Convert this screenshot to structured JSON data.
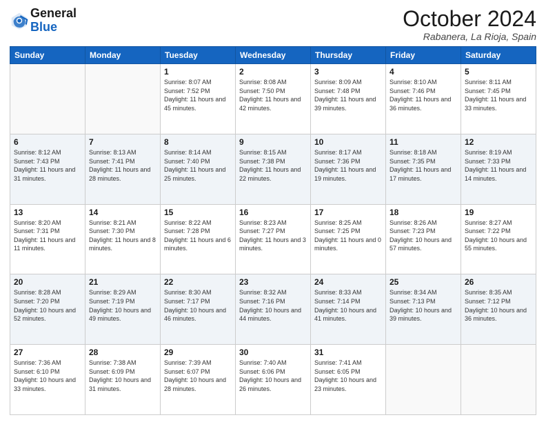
{
  "header": {
    "logo_general": "General",
    "logo_blue": "Blue",
    "month": "October 2024",
    "location": "Rabanera, La Rioja, Spain"
  },
  "weekdays": [
    "Sunday",
    "Monday",
    "Tuesday",
    "Wednesday",
    "Thursday",
    "Friday",
    "Saturday"
  ],
  "weeks": [
    [
      {
        "day": "",
        "info": ""
      },
      {
        "day": "",
        "info": ""
      },
      {
        "day": "1",
        "info": "Sunrise: 8:07 AM\nSunset: 7:52 PM\nDaylight: 11 hours and 45 minutes."
      },
      {
        "day": "2",
        "info": "Sunrise: 8:08 AM\nSunset: 7:50 PM\nDaylight: 11 hours and 42 minutes."
      },
      {
        "day": "3",
        "info": "Sunrise: 8:09 AM\nSunset: 7:48 PM\nDaylight: 11 hours and 39 minutes."
      },
      {
        "day": "4",
        "info": "Sunrise: 8:10 AM\nSunset: 7:46 PM\nDaylight: 11 hours and 36 minutes."
      },
      {
        "day": "5",
        "info": "Sunrise: 8:11 AM\nSunset: 7:45 PM\nDaylight: 11 hours and 33 minutes."
      }
    ],
    [
      {
        "day": "6",
        "info": "Sunrise: 8:12 AM\nSunset: 7:43 PM\nDaylight: 11 hours and 31 minutes."
      },
      {
        "day": "7",
        "info": "Sunrise: 8:13 AM\nSunset: 7:41 PM\nDaylight: 11 hours and 28 minutes."
      },
      {
        "day": "8",
        "info": "Sunrise: 8:14 AM\nSunset: 7:40 PM\nDaylight: 11 hours and 25 minutes."
      },
      {
        "day": "9",
        "info": "Sunrise: 8:15 AM\nSunset: 7:38 PM\nDaylight: 11 hours and 22 minutes."
      },
      {
        "day": "10",
        "info": "Sunrise: 8:17 AM\nSunset: 7:36 PM\nDaylight: 11 hours and 19 minutes."
      },
      {
        "day": "11",
        "info": "Sunrise: 8:18 AM\nSunset: 7:35 PM\nDaylight: 11 hours and 17 minutes."
      },
      {
        "day": "12",
        "info": "Sunrise: 8:19 AM\nSunset: 7:33 PM\nDaylight: 11 hours and 14 minutes."
      }
    ],
    [
      {
        "day": "13",
        "info": "Sunrise: 8:20 AM\nSunset: 7:31 PM\nDaylight: 11 hours and 11 minutes."
      },
      {
        "day": "14",
        "info": "Sunrise: 8:21 AM\nSunset: 7:30 PM\nDaylight: 11 hours and 8 minutes."
      },
      {
        "day": "15",
        "info": "Sunrise: 8:22 AM\nSunset: 7:28 PM\nDaylight: 11 hours and 6 minutes."
      },
      {
        "day": "16",
        "info": "Sunrise: 8:23 AM\nSunset: 7:27 PM\nDaylight: 11 hours and 3 minutes."
      },
      {
        "day": "17",
        "info": "Sunrise: 8:25 AM\nSunset: 7:25 PM\nDaylight: 11 hours and 0 minutes."
      },
      {
        "day": "18",
        "info": "Sunrise: 8:26 AM\nSunset: 7:23 PM\nDaylight: 10 hours and 57 minutes."
      },
      {
        "day": "19",
        "info": "Sunrise: 8:27 AM\nSunset: 7:22 PM\nDaylight: 10 hours and 55 minutes."
      }
    ],
    [
      {
        "day": "20",
        "info": "Sunrise: 8:28 AM\nSunset: 7:20 PM\nDaylight: 10 hours and 52 minutes."
      },
      {
        "day": "21",
        "info": "Sunrise: 8:29 AM\nSunset: 7:19 PM\nDaylight: 10 hours and 49 minutes."
      },
      {
        "day": "22",
        "info": "Sunrise: 8:30 AM\nSunset: 7:17 PM\nDaylight: 10 hours and 46 minutes."
      },
      {
        "day": "23",
        "info": "Sunrise: 8:32 AM\nSunset: 7:16 PM\nDaylight: 10 hours and 44 minutes."
      },
      {
        "day": "24",
        "info": "Sunrise: 8:33 AM\nSunset: 7:14 PM\nDaylight: 10 hours and 41 minutes."
      },
      {
        "day": "25",
        "info": "Sunrise: 8:34 AM\nSunset: 7:13 PM\nDaylight: 10 hours and 39 minutes."
      },
      {
        "day": "26",
        "info": "Sunrise: 8:35 AM\nSunset: 7:12 PM\nDaylight: 10 hours and 36 minutes."
      }
    ],
    [
      {
        "day": "27",
        "info": "Sunrise: 7:36 AM\nSunset: 6:10 PM\nDaylight: 10 hours and 33 minutes."
      },
      {
        "day": "28",
        "info": "Sunrise: 7:38 AM\nSunset: 6:09 PM\nDaylight: 10 hours and 31 minutes."
      },
      {
        "day": "29",
        "info": "Sunrise: 7:39 AM\nSunset: 6:07 PM\nDaylight: 10 hours and 28 minutes."
      },
      {
        "day": "30",
        "info": "Sunrise: 7:40 AM\nSunset: 6:06 PM\nDaylight: 10 hours and 26 minutes."
      },
      {
        "day": "31",
        "info": "Sunrise: 7:41 AM\nSunset: 6:05 PM\nDaylight: 10 hours and 23 minutes."
      },
      {
        "day": "",
        "info": ""
      },
      {
        "day": "",
        "info": ""
      }
    ]
  ]
}
